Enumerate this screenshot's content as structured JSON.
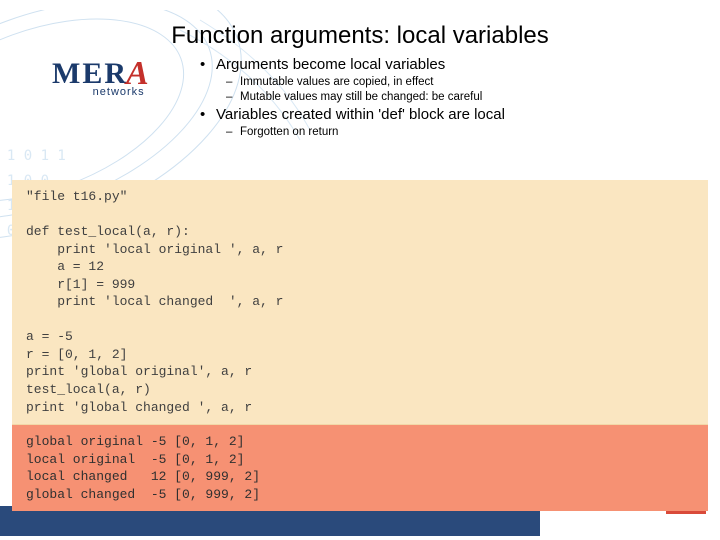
{
  "title": "Function arguments: local variables",
  "logo": {
    "brand": "MERA",
    "sub": "networks"
  },
  "bullets": {
    "b1": "Arguments become local variables",
    "b1a": "Immutable values are copied, in effect",
    "b1b": "Mutable values may still be changed: be careful",
    "b2": "Variables created within 'def' block are local",
    "b2a": "Forgotten on return"
  },
  "code": {
    "source": "\"file t16.py\"\n\ndef test_local(a, r):\n    print 'local original ', a, r\n    a = 12\n    r[1] = 999\n    print 'local changed  ', a, r\n\na = -5\nr = [0, 1, 2]\nprint 'global original', a, r\ntest_local(a, r)\nprint 'global changed ', a, r",
    "output": "global original -5 [0, 1, 2]\nlocal original  -5 [0, 1, 2]\nlocal changed   12 [0, 999, 2]\nglobal changed  -5 [0, 999, 2]"
  }
}
